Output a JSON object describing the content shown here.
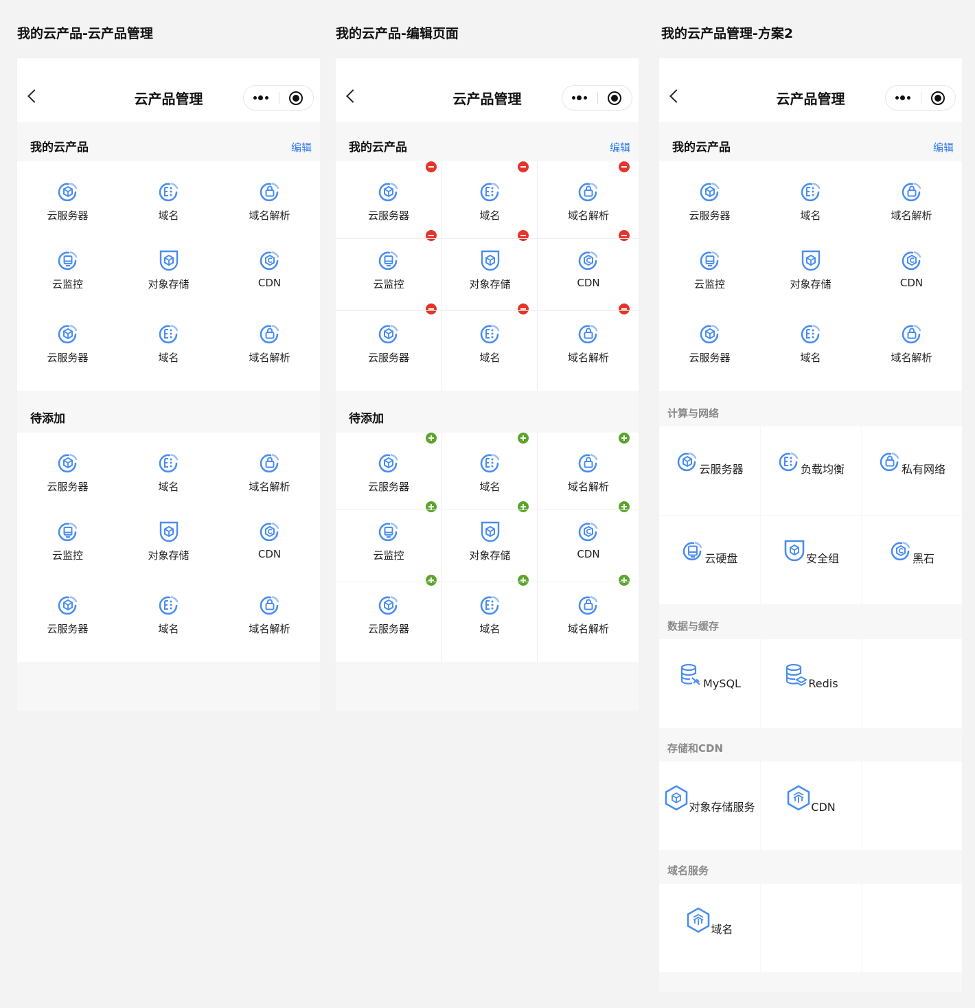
{
  "columns": [
    {
      "title": "我的云产品-云产品管理"
    },
    {
      "title": "我的云产品-编辑页面"
    },
    {
      "title": "我的云产品管理-方案2"
    }
  ],
  "nav": {
    "title": "云产品管理"
  },
  "sections": {
    "mine": "我的云产品",
    "edit": "编辑",
    "pending": "待添加"
  },
  "products": [
    {
      "label": "云服务器",
      "icon": "cloud-server-icon"
    },
    {
      "label": "域名",
      "icon": "domain-icon"
    },
    {
      "label": "域名解析",
      "icon": "dns-lock-icon"
    },
    {
      "label": "云监控",
      "icon": "monitor-icon"
    },
    {
      "label": "对象存储",
      "icon": "shield-storage-icon"
    },
    {
      "label": "CDN",
      "icon": "cdn-icon"
    },
    {
      "label": "云服务器",
      "icon": "cloud-server-icon"
    },
    {
      "label": "域名",
      "icon": "domain-icon"
    },
    {
      "label": "域名解析",
      "icon": "dns-lock-icon"
    }
  ],
  "categories": [
    {
      "title": "计算与网络",
      "items": [
        {
          "label": "云服务器",
          "icon": "cloud-server-icon"
        },
        {
          "label": "负载均衡",
          "icon": "load-balance-icon"
        },
        {
          "label": "私有网络",
          "icon": "vpc-lock-icon"
        },
        {
          "label": "云硬盘",
          "icon": "cloud-disk-icon"
        },
        {
          "label": "安全组",
          "icon": "security-group-icon"
        },
        {
          "label": "黑石",
          "icon": "bare-metal-icon"
        }
      ]
    },
    {
      "title": "数据与缓存",
      "items": [
        {
          "label": "MySQL",
          "icon": "mysql-icon"
        },
        {
          "label": "Redis",
          "icon": "redis-icon"
        }
      ]
    },
    {
      "title": "存储和CDN",
      "items": [
        {
          "label": "对象存储服务",
          "icon": "object-storage-icon"
        },
        {
          "label": "CDN",
          "icon": "cdn-hex-icon"
        }
      ]
    },
    {
      "title": "域名服务",
      "items": [
        {
          "label": "域名",
          "icon": "domain-hex-icon"
        }
      ]
    }
  ],
  "colors": {
    "accent": "#2f7be6",
    "icon": "#4a8df0",
    "delete": "#e5352b",
    "add": "#5aa52a"
  }
}
